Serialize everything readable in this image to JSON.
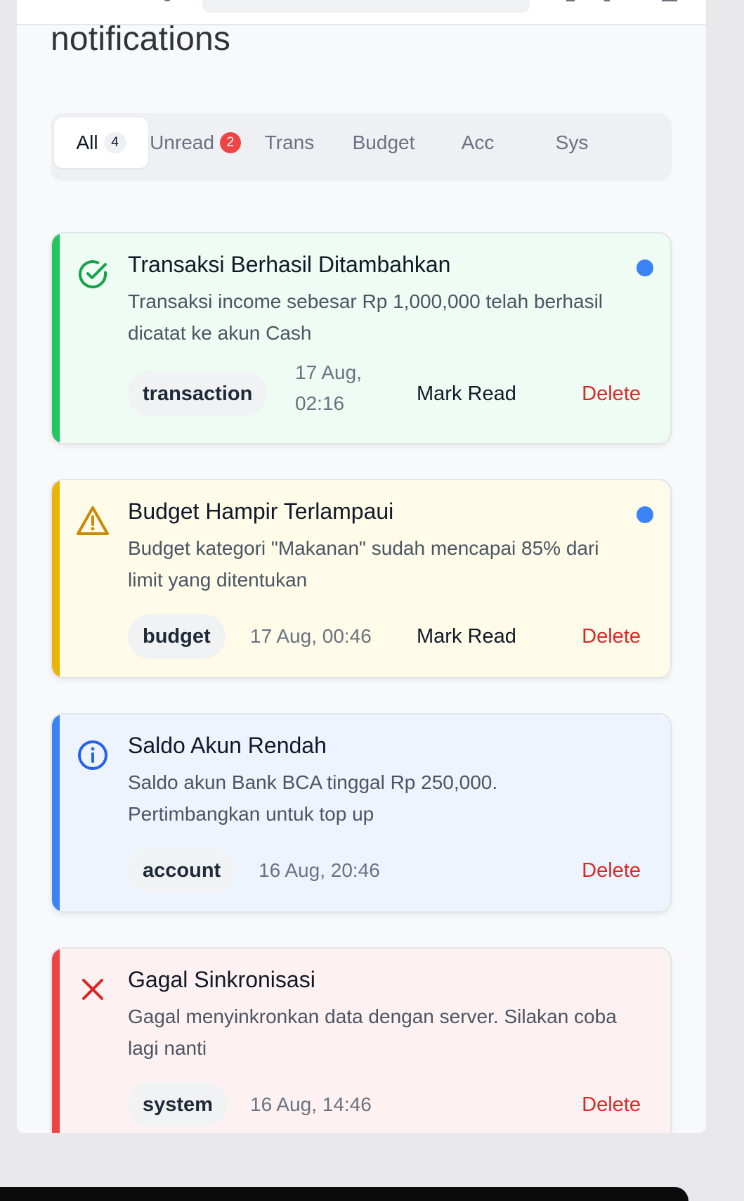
{
  "page": {
    "title": "notifications"
  },
  "tabs": [
    {
      "label": "All",
      "count": "4"
    },
    {
      "label": "Unread",
      "badge": "2"
    },
    {
      "label": "Trans"
    },
    {
      "label": "Budget"
    },
    {
      "label": "Acc"
    },
    {
      "label": "Sys"
    }
  ],
  "colors": {
    "success": "#22c55e",
    "warning": "#eab308",
    "info": "#3b82f6",
    "error": "#ef4444",
    "delete": "#dc2626",
    "unread_dot": "#3b82f6"
  },
  "notifications": [
    {
      "icon": "check-circle-icon",
      "title": "Transaksi Berhasil Ditambahkan",
      "message": "Transaksi income sebesar Rp 1,000,000 telah berhasil dicatat ke akun Cash",
      "tag": "transaction",
      "time": "17 Aug, 02:16",
      "unread": true,
      "mark_read_label": "Mark Read",
      "delete_label": "Delete"
    },
    {
      "icon": "warning-triangle-icon",
      "title": "Budget Hampir Terlampaui",
      "message": "Budget kategori \"Makanan\" sudah mencapai 85% dari limit yang ditentukan",
      "tag": "budget",
      "time": "17 Aug, 00:46",
      "unread": true,
      "mark_read_label": "Mark Read",
      "delete_label": "Delete"
    },
    {
      "icon": "info-circle-icon",
      "title": "Saldo Akun Rendah",
      "message": "Saldo akun Bank BCA tinggal Rp 250,000. Pertimbangkan untuk top up",
      "tag": "account",
      "time": "16 Aug, 20:46",
      "unread": false,
      "delete_label": "Delete"
    },
    {
      "icon": "x-icon",
      "title": "Gagal Sinkronisasi",
      "message": "Gagal menyinkronkan data dengan server. Silakan coba lagi nanti",
      "tag": "system",
      "time": "16 Aug, 14:46",
      "unread": false,
      "delete_label": "Delete"
    }
  ]
}
